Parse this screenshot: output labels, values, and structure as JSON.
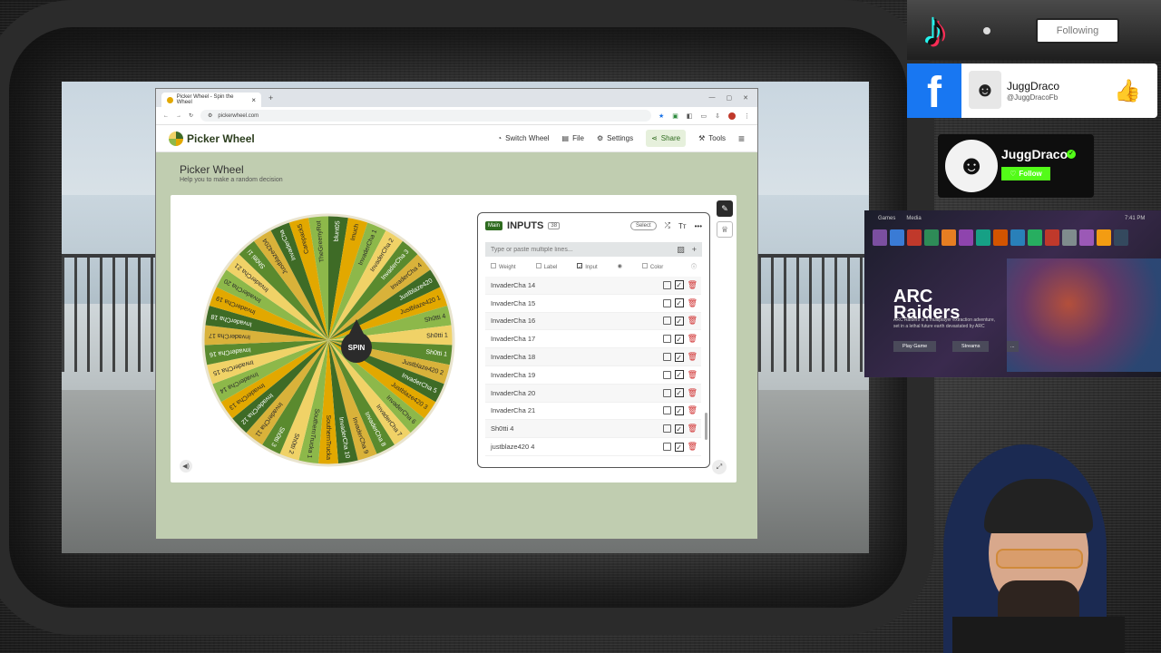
{
  "overlay": {
    "tiktok_follow": "Following",
    "facebook": {
      "name": "JuggDraco",
      "handle": "@JuggDracoFb"
    },
    "kick": {
      "name": "JuggDraco",
      "follow": "Follow"
    },
    "xbox": {
      "tabs": [
        "Games",
        "Media"
      ],
      "time": "7:41 PM",
      "game_title_line1": "ARC",
      "game_title_line2": "Raiders",
      "description": "ARC Raiders is a multiplayer extraction adventure, set in a lethal future earth devastated by ARC",
      "play_label": "Play Game",
      "streams_label": "Streams",
      "more_label": "..."
    }
  },
  "browser": {
    "tab_title": "Picker Wheel - Spin the Wheel",
    "url": "pickerwheel.com"
  },
  "site": {
    "logo": "Picker Wheel",
    "nav": {
      "switch_wheel": "Switch Wheel",
      "file": "File",
      "settings": "Settings",
      "share": "Share",
      "tools": "Tools"
    },
    "page_title": "Picker Wheel",
    "page_subtitle": "Help you to make a random decision",
    "spin_label": "SPIN",
    "wheel_slices": [
      "blunt05",
      "Imuch",
      "InvaderCha 1",
      "InvaderCha 2",
      "InvaderCha 3",
      "InvaderCha 4",
      "Justblaze420",
      "Justblaze420 1",
      "Sh0tti 4",
      "Sh0tti 1",
      "Sh0tti 1",
      "Justblaze420 2",
      "InvaderCha 5",
      "Justblaze420 3",
      "InvaderCha 6",
      "InvaderCha 7",
      "InvaderCha 8",
      "InvaderCha 9",
      "InvaderCha 10",
      "SouthernTrucka",
      "SouthernTrucka 1",
      "Sh0tti 2",
      "Sh0tti 3",
      "InvaderCha 11",
      "InvaderCha 12",
      "InvaderCha 13",
      "InvaderCha 14",
      "InvaderCha 15",
      "InvaderCha 16",
      "InvaderCha 17",
      "InvaderCha 18",
      "InvaderCha 19",
      "InvaderCha 20",
      "InvaderCha 21",
      "Sh0tti 1i",
      "Justblaze4204",
      "InvaderCha",
      "Carepack5",
      "TheGreenyRot"
    ],
    "slice_colors": [
      "#3e6b26",
      "#e2a800",
      "#8db84a",
      "#f0d267",
      "#5a8a2e",
      "#d9b23a"
    ],
    "inputs": {
      "main_badge": "Main",
      "title": "INPUTS",
      "count": "38",
      "select_label": "Select",
      "placeholder": "Type or paste multiple lines...",
      "col_weight": "Weight",
      "col_label": "Label",
      "col_input": "Input",
      "col_color": "Color",
      "items": [
        "InvaderCha 14",
        "InvaderCha 15",
        "InvaderCha 16",
        "InvaderCha 17",
        "InvaderCha 18",
        "InvaderCha 19",
        "InvaderCha 20",
        "InvaderCha 21",
        "Sh0tti 4",
        "justblaze420 4"
      ]
    }
  }
}
